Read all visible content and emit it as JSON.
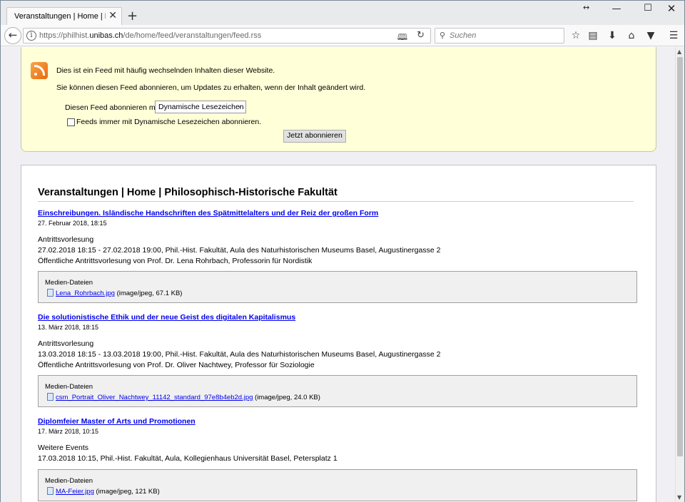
{
  "browser": {
    "tab_title": "Veranstaltungen | Home | Phil...",
    "new_tab_symbol": "+",
    "url_prefix": "https://philhist.",
    "url_domain": "unibas.ch",
    "url_path": "/de/home/feed/veranstaltungen/feed.rss",
    "search_placeholder": "Suchen"
  },
  "subscribe": {
    "line1": "Dies ist ein Feed mit häufig wechselnden Inhalten dieser Website.",
    "line2": "Sie können diesen Feed abonnieren, um Updates zu erhalten, wenn der Inhalt geändert wird.",
    "subscribe_with_label": "Diesen Feed abonnieren mit",
    "selected_reader": "Dynamische Lesezeichen",
    "always_label": "Feeds immer mit Dynamische Lesezeichen abonnieren.",
    "button_label": "Jetzt abonnieren"
  },
  "feed": {
    "title": "Veranstaltungen | Home | Philosophisch-Historische Fakultät",
    "entries": [
      {
        "title": "Einschreibungen. Isländische Handschriften des Spätmittelalters und der Reiz der großen Form",
        "date": "27. Februar 2018, 18:15",
        "lines": [
          "Antrittsvorlesung",
          "27.02.2018 18:15 - 27.02.2018 19:00, Phil.-Hist. Fakultät, Aula des Naturhistorischen Museums Basel, Augustinergasse 2",
          "Öffentliche Antrittsvorlesung von Prof. Dr. Lena Rohrbach, Professorin für Nordistik"
        ],
        "media_label": "Medien-Dateien",
        "file_name": "Lena_Rohrbach.jpg",
        "file_info": "(image/jpeg, 67.1 KB)"
      },
      {
        "title": "Die solutionistische Ethik und der neue Geist des digitalen Kapitalismus",
        "date": "13. März 2018, 18:15",
        "lines": [
          "Antrittsvorlesung",
          "13.03.2018 18:15 - 13.03.2018 19:00, Phil.-Hist. Fakultät, Aula des Naturhistorischen Museums Basel, Augustinergasse 2",
          "Öffentliche Antrittsvorlesung von Prof. Dr. Oliver Nachtwey, Professor für Soziologie"
        ],
        "media_label": "Medien-Dateien",
        "file_name": "csm_Portrait_Oliver_Nachtwey_11142_standard_97e8b4eb2d.jpg",
        "file_info": "(image/jpeg, 24.0 KB)"
      },
      {
        "title": "Diplomfeier Master of Arts und Promotionen",
        "date": "17. März 2018, 10:15",
        "lines": [
          "Weitere Events",
          "17.03.2018 10:15, Phil.-Hist. Fakultät, Aula, Kollegienhaus Universität Basel, Petersplatz 1"
        ],
        "media_label": "Medien-Dateien",
        "file_name": "MA-Feier.jpg",
        "file_info": "(image/jpeg, 121 KB)"
      }
    ]
  }
}
